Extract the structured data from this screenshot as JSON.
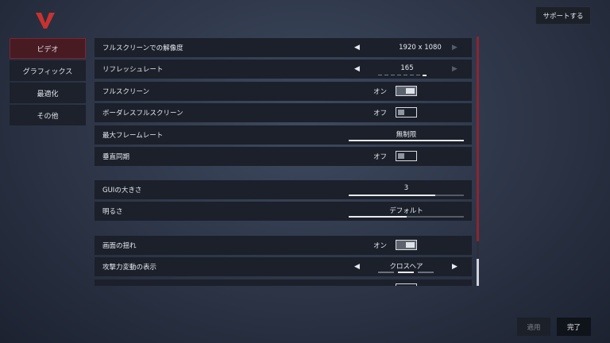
{
  "header": {
    "support_label": "サポートする"
  },
  "sidebar": {
    "items": [
      {
        "label": "ビデオ",
        "active": true
      },
      {
        "label": "グラフィックス",
        "active": false
      },
      {
        "label": "最適化",
        "active": false
      },
      {
        "label": "その他",
        "active": false
      }
    ]
  },
  "settings": {
    "resolution": {
      "label": "フルスクリーンでの解像度",
      "value": "1920 x 1080"
    },
    "refresh_rate": {
      "label": "リフレッシュレート",
      "value": "165"
    },
    "fullscreen": {
      "label": "フルスクリーン",
      "state": "オン"
    },
    "borderless": {
      "label": "ボーダレスフルスクリーン",
      "state": "オフ"
    },
    "max_fps": {
      "label": "最大フレームレート",
      "value": "無制限",
      "level": 1.0
    },
    "vsync": {
      "label": "垂直同期",
      "state": "オフ"
    },
    "gui_size": {
      "label": "GUIの大きさ",
      "value": "3",
      "level": 0.75
    },
    "brightness": {
      "label": "明るさ",
      "value": "デフォルト",
      "level": 0.5
    },
    "screen_shake": {
      "label": "画面の揺れ",
      "state": "オン"
    },
    "attack_display": {
      "label": "攻撃力変動の表示",
      "value": "クロスヘア"
    }
  },
  "footer": {
    "apply_label": "適用",
    "done_label": "完了"
  },
  "colors": {
    "accent_red": "#8d2431",
    "active_tab": "#481a22"
  }
}
